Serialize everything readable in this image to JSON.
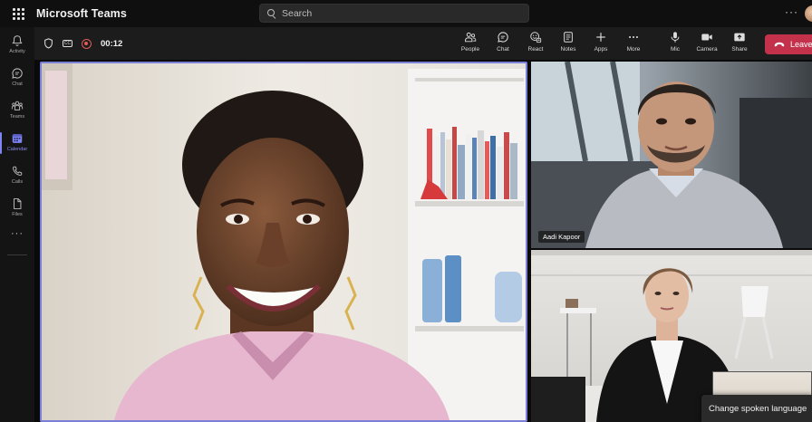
{
  "titlebar": {
    "app_title": "Microsoft Teams",
    "search_placeholder": "Search",
    "more": "···"
  },
  "rail": {
    "items": [
      {
        "label": "Activity",
        "icon": "bell-icon"
      },
      {
        "label": "Chat",
        "icon": "chat-icon"
      },
      {
        "label": "Teams",
        "icon": "teams-icon"
      },
      {
        "label": "Calendar",
        "icon": "calendar-icon",
        "active": true
      },
      {
        "label": "Calls",
        "icon": "phone-icon"
      },
      {
        "label": "Files",
        "icon": "file-icon"
      }
    ],
    "more": "···"
  },
  "meeting": {
    "timer": "00:12",
    "tools": [
      {
        "label": "People",
        "icon": "people-icon"
      },
      {
        "label": "Chat",
        "icon": "chat-icon"
      },
      {
        "label": "React",
        "icon": "react-icon"
      },
      {
        "label": "Notes",
        "icon": "notes-icon"
      },
      {
        "label": "Apps",
        "icon": "plus-icon"
      },
      {
        "label": "More",
        "icon": "more-icon"
      },
      {
        "label": "Mic",
        "icon": "mic-icon"
      },
      {
        "label": "Camera",
        "icon": "camera-icon"
      },
      {
        "label": "Share",
        "icon": "share-icon"
      }
    ],
    "leave_label": "Leave",
    "accent": "#7b7fd8",
    "leave_color": "#c4314b"
  },
  "participants": {
    "top_right_name": "Aadi Kapoor"
  },
  "caption_menu": {
    "label": "Change spoken language"
  }
}
